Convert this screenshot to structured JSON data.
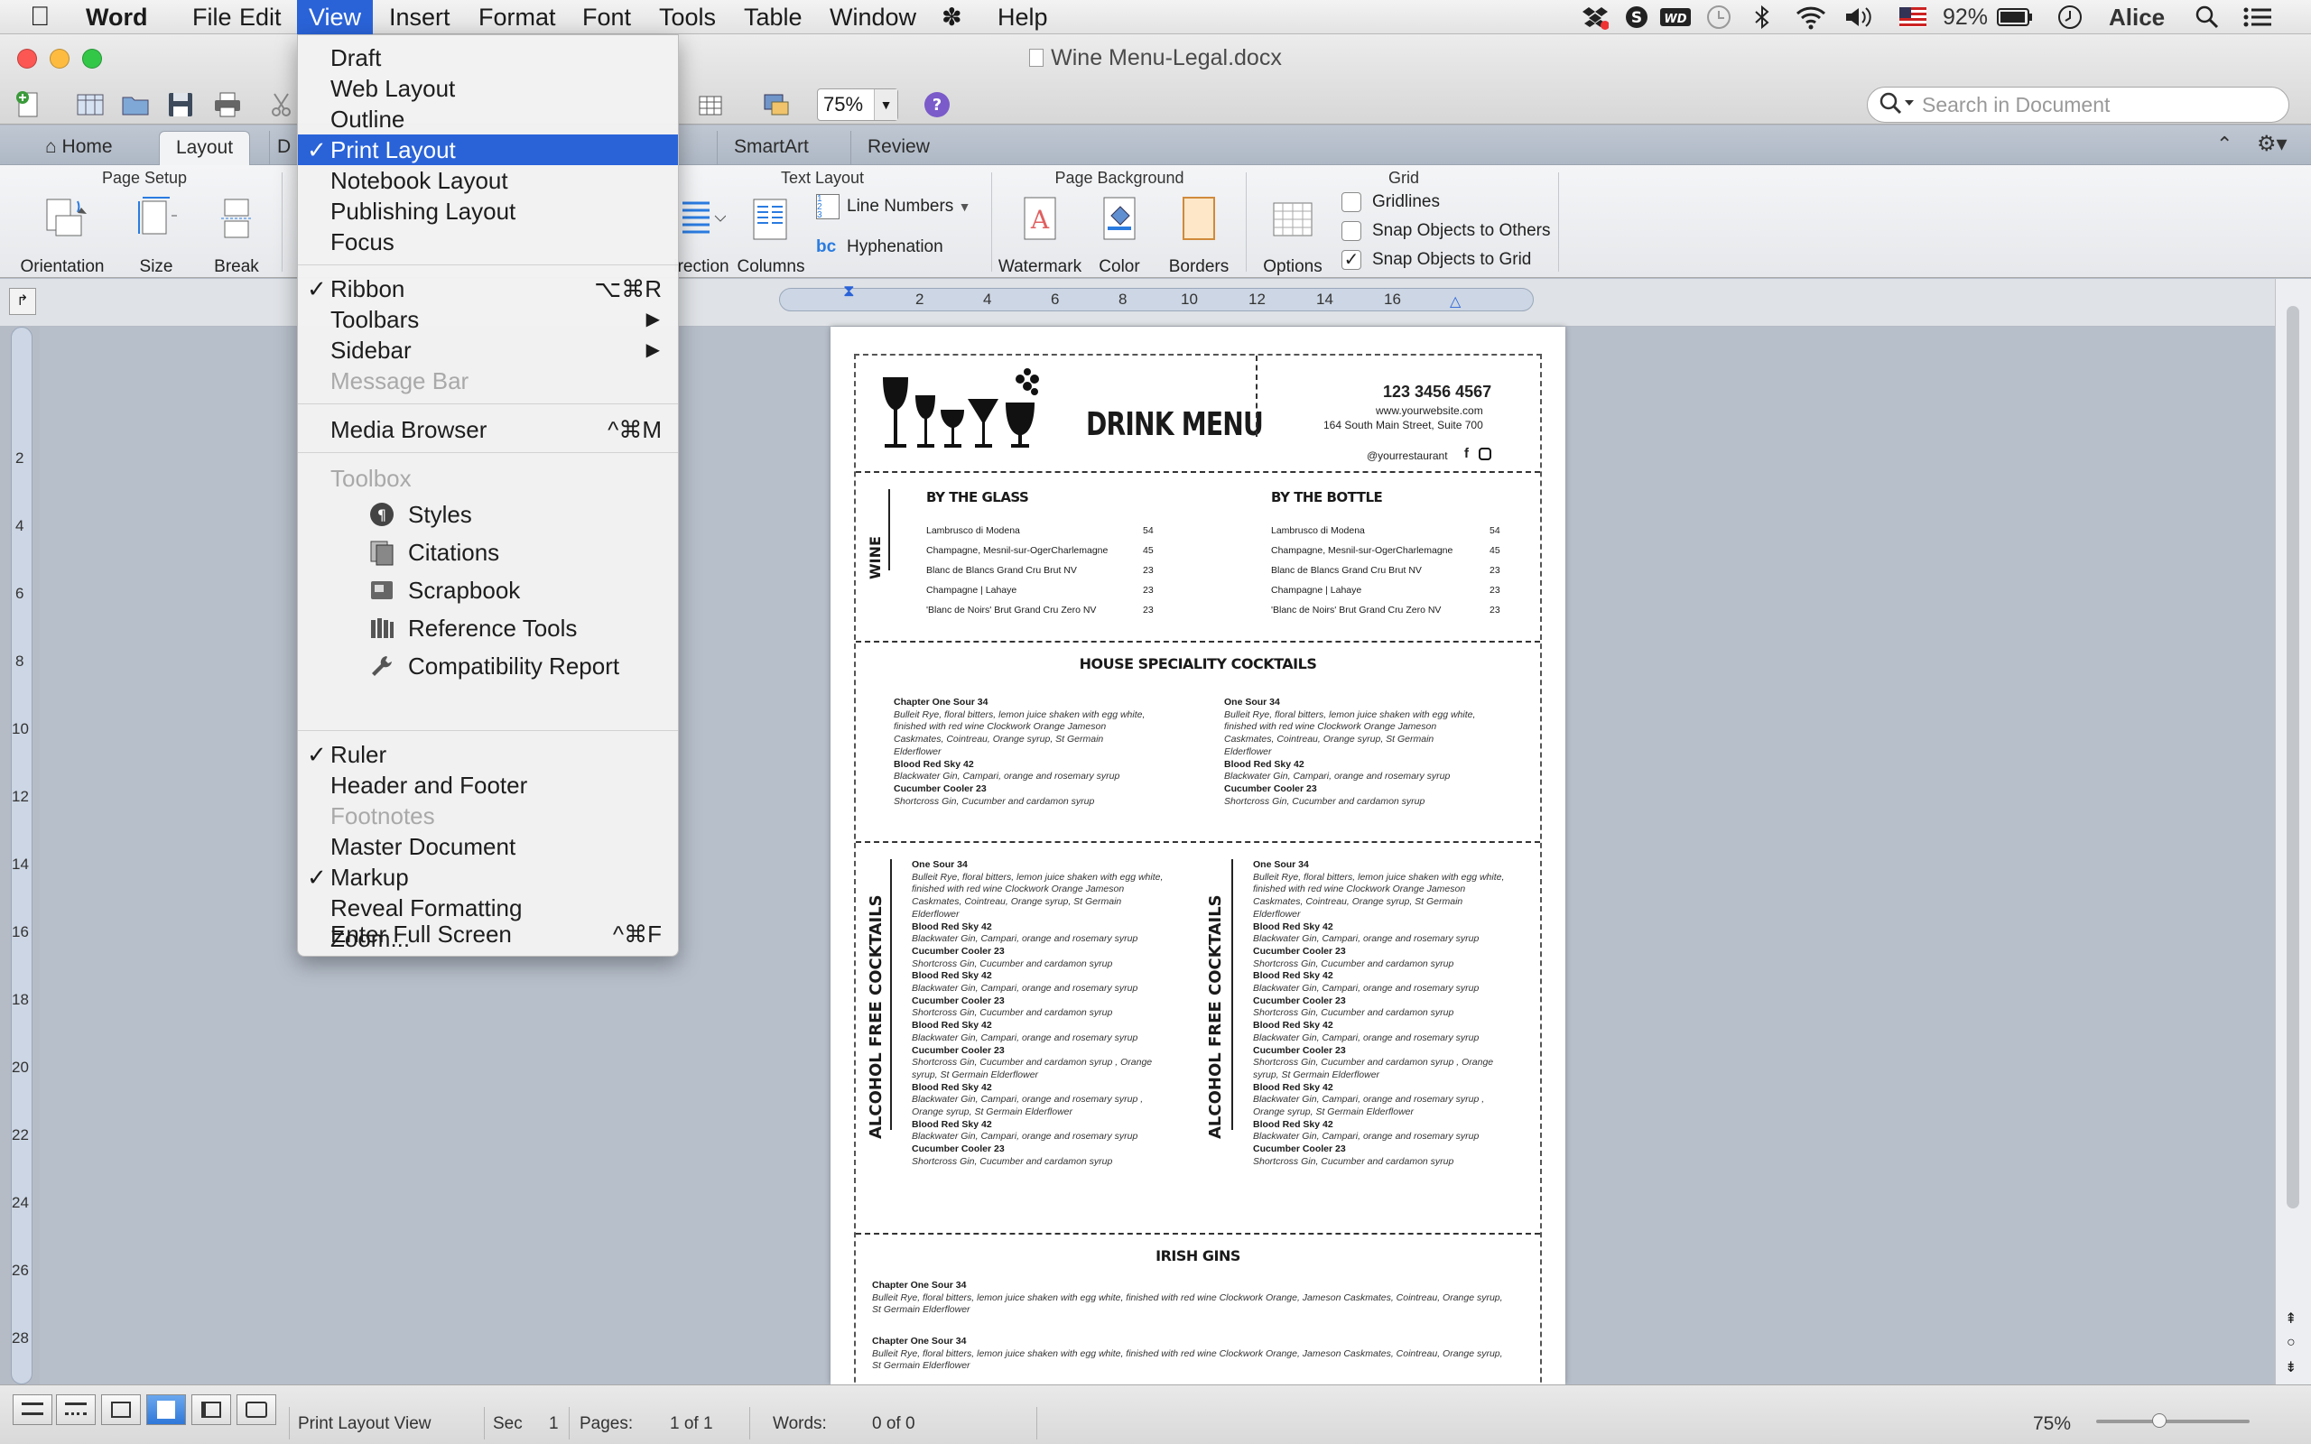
{
  "menubar": {
    "app_name": "Word",
    "items": [
      "File",
      "Edit",
      "View",
      "Insert",
      "Format",
      "Font",
      "Tools",
      "Table",
      "Window",
      "Help"
    ],
    "battery": "92%",
    "user": "Alice"
  },
  "window": {
    "title": "Wine Menu-Legal.docx",
    "zoom": "75%",
    "search_placeholder": "Search in Document"
  },
  "ribbon_tabs": [
    "Home",
    "Layout",
    "SmartArt",
    "Review"
  ],
  "ribbon_tab_partial": "D",
  "ribbon_tab_partial_s": "s",
  "ribbon": {
    "page_setup": {
      "title": "Page Setup",
      "buttons": [
        "Orientation",
        "Size",
        "Break"
      ]
    },
    "text_layout": {
      "title": "Text Layout",
      "buttons": [
        "irection",
        "Columns"
      ],
      "line_numbers": "Line Numbers",
      "hyphenation": "Hyphenation"
    },
    "page_background": {
      "title": "Page Background",
      "buttons": [
        "Watermark",
        "Color",
        "Borders"
      ]
    },
    "grid": {
      "title": "Grid",
      "options": "Options",
      "gridlines": "Gridlines",
      "snap_others": "Snap Objects to Others",
      "snap_grid": "Snap Objects to Grid"
    }
  },
  "ruler": {
    "h_ticks": [
      "2",
      "4",
      "6",
      "8",
      "10",
      "12",
      "14",
      "16"
    ],
    "v_ticks": [
      "2",
      "4",
      "6",
      "8",
      "10",
      "12",
      "14",
      "16",
      "18",
      "20",
      "22",
      "24",
      "26",
      "28"
    ]
  },
  "view_menu": {
    "items": [
      {
        "label": "Draft"
      },
      {
        "label": "Web Layout"
      },
      {
        "label": "Outline"
      },
      {
        "label": "Print Layout",
        "checked": "✓"
      },
      {
        "label": "Notebook Layout"
      },
      {
        "label": "Publishing Layout"
      },
      {
        "label": "Focus"
      },
      {
        "label": "Ribbon",
        "checked": "✓",
        "shortcut": "⌥⌘R"
      },
      {
        "label": "Toolbars"
      },
      {
        "label": "Sidebar"
      },
      {
        "label": "Message Bar"
      },
      {
        "label": "Media Browser",
        "shortcut": "^⌘M"
      },
      {
        "label": "Toolbox"
      },
      {
        "label": "Styles"
      },
      {
        "label": "Citations"
      },
      {
        "label": "Scrapbook"
      },
      {
        "label": "Reference Tools"
      },
      {
        "label": "Compatibility Report"
      },
      {
        "label": "Ruler",
        "checked": "✓"
      },
      {
        "label": "Header and Footer"
      },
      {
        "label": "Footnotes"
      },
      {
        "label": "Master Document"
      },
      {
        "label": "Markup",
        "checked": "✓"
      },
      {
        "label": "Reveal Formatting"
      },
      {
        "label": "Zoom..."
      },
      {
        "label": "Enter Full Screen",
        "shortcut": "^⌘F"
      }
    ],
    "submenu_arrow": "▶"
  },
  "document": {
    "title": "DRINK MENU",
    "phone": "123 3456 4567",
    "website": "www.yourwebsite.com",
    "address": "164 South Main Street, Suite 700",
    "handle": "@yourrestaurant",
    "wine_label": "WINE",
    "by_glass": "BY THE GLASS",
    "by_bottle": "BY THE BOTTLE",
    "wines": [
      {
        "name": "Lambrusco di Modena",
        "price": "54"
      },
      {
        "name": "Champagne, Mesnil-sur-OgerCharlemagne",
        "price": "45"
      },
      {
        "name": "Blanc de Blancs Grand Cru Brut NV",
        "price": "23"
      },
      {
        "name": "Champagne | Lahaye",
        "price": "23"
      },
      {
        "name": "'Blanc de Noirs' Brut Grand Cru Zero NV",
        "price": "23"
      }
    ],
    "house_title": "HOUSE SPECIALITY COCKTAILS",
    "house_left": {
      "t1": "Chapter One Sour 34",
      "d1": "Bulleit Rye, floral bitters, lemon juice shaken with egg white, finished with red wine Clockwork Orange Jameson Caskmates, Cointreau, Orange syrup, St Germain Elderflower",
      "t2": "Blood Red Sky 42",
      "d2": "Blackwater Gin, Campari, orange and rosemary syrup",
      "t3": "Cucumber Cooler 23",
      "d3": "Shortcross Gin, Cucumber and cardamon syrup"
    },
    "house_right": {
      "t1": "One Sour 34",
      "d1": "Bulleit Rye, floral bitters, lemon juice shaken with egg white, finished with red wine Clockwork Orange Jameson Caskmates, Cointreau, Orange syrup, St Germain Elderflower",
      "t2": "Blood Red Sky 42",
      "d2": "Blackwater Gin, Campari, orange and rosemary syrup",
      "t3": "Cucumber Cooler 23",
      "d3": "Shortcross Gin, Cucumber and cardamon syrup"
    },
    "af_label": "ALCOHOL FREE COCKTAILS",
    "af_items": [
      {
        "t": "One Sour 34",
        "d": "Bulleit Rye, floral bitters, lemon juice shaken with egg white, finished with red wine Clockwork Orange Jameson Caskmates, Cointreau, Orange syrup, St Germain Elderflower"
      },
      {
        "t": "Blood Red Sky 42",
        "d": "Blackwater Gin, Campari, orange and rosemary syrup"
      },
      {
        "t": "Cucumber Cooler 23",
        "d": "Shortcross Gin, Cucumber and cardamon syrup"
      },
      {
        "t": "Blood Red Sky 42",
        "d": "Blackwater Gin, Campari, orange and rosemary syrup"
      },
      {
        "t": "Cucumber Cooler 23",
        "d": "Shortcross Gin, Cucumber and cardamon syrup"
      },
      {
        "t": "Blood Red Sky 42",
        "d": "Blackwater Gin, Campari, orange and rosemary syrup"
      },
      {
        "t": "Cucumber Cooler 23",
        "d": "Shortcross Gin, Cucumber and cardamon syrup , Orange syrup, St Germain Elderflower"
      },
      {
        "t": "Blood Red Sky 42",
        "d": "Blackwater Gin, Campari, orange and rosemary syrup , Orange syrup, St Germain Elderflower"
      },
      {
        "t": "Blood Red Sky 42",
        "d": "Blackwater Gin, Campari, orange and rosemary syrup"
      },
      {
        "t": "Cucumber Cooler 23",
        "d": "Shortcross Gin, Cucumber and cardamon syrup"
      }
    ],
    "irish_title": "IRISH GINS",
    "irish_items": [
      {
        "t": "Chapter One Sour 34",
        "d": "Bulleit Rye, floral bitters, lemon juice shaken with egg white, finished with red wine Clockwork Orange, Jameson Caskmates, Cointreau, Orange syrup, St Germain Elderflower"
      },
      {
        "t": "Chapter One Sour 34",
        "d": "Bulleit Rye, floral bitters, lemon juice shaken with egg white, finished with red wine Clockwork Orange, Jameson Caskmates, Cointreau, Orange syrup, St Germain Elderflower"
      }
    ]
  },
  "statusbar": {
    "view": "Print Layout View",
    "sec_label": "Sec",
    "sec": "1",
    "pages_label": "Pages:",
    "pages": "1 of 1",
    "words_label": "Words:",
    "words": "0 of 0",
    "zoom": "75%"
  },
  "colors": {
    "accent": "#2a63d8",
    "ruler": "#ccd6e4"
  }
}
